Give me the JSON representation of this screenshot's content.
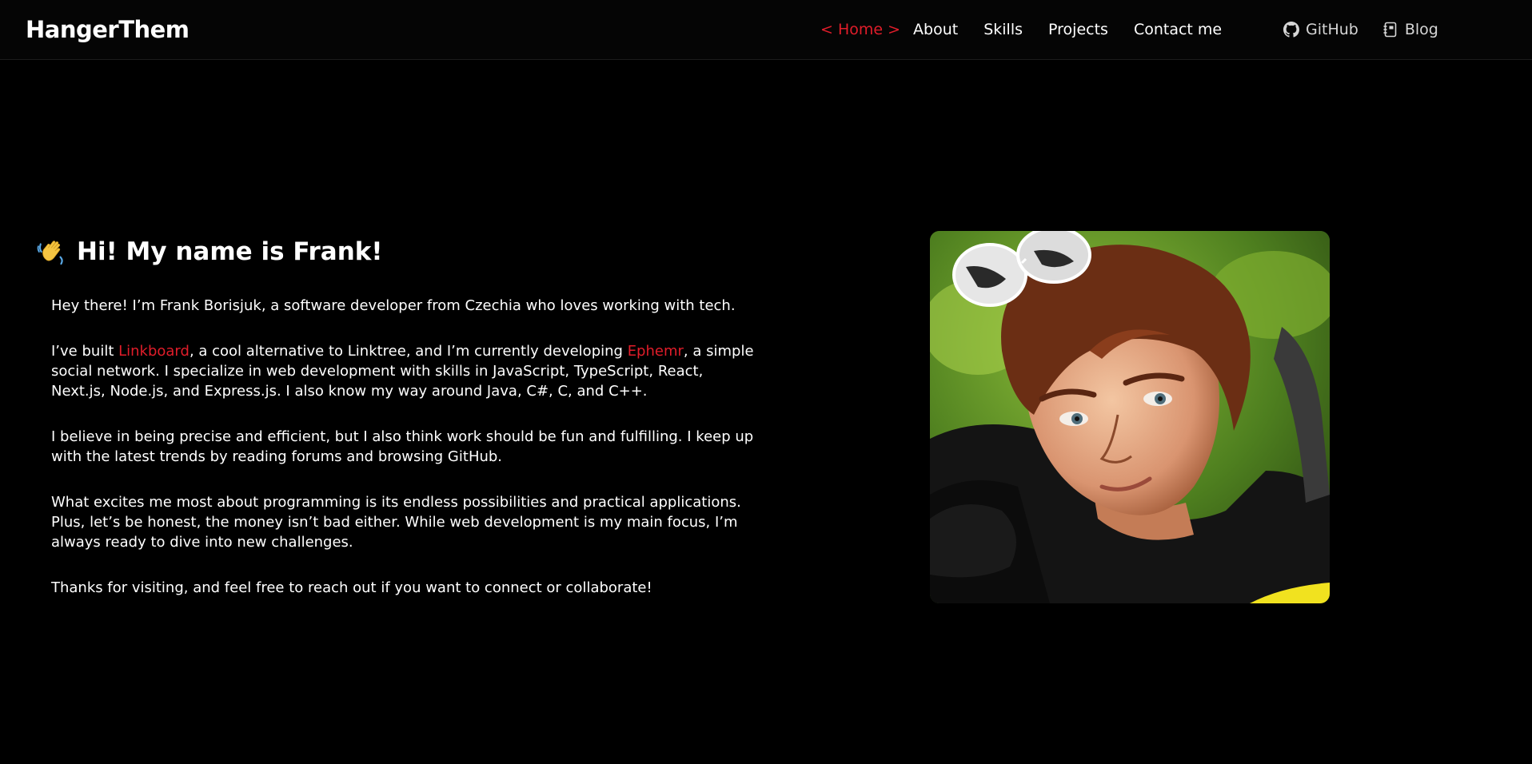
{
  "header": {
    "logo": "HangerThem",
    "nav": {
      "home": "< Home >",
      "about": "About",
      "skills": "Skills",
      "projects": "Projects",
      "contact": "Contact me"
    },
    "external": {
      "github": "GitHub",
      "blog": "Blog"
    }
  },
  "hero": {
    "title": "Hi! My name is Frank!",
    "p1": "Hey there! I’m Frank Borisjuk, a software developer from Czechia who loves working with tech.",
    "p2": {
      "t1": "I’ve built ",
      "link1": "Linkboard",
      "t2": ", a cool alternative to Linktree, and I’m currently developing ",
      "link2": "Ephemr",
      "t3": ", a simple social network. I specialize in web development with skills in JavaScript, TypeScript, React, Next.js, Node.js, and Express.js. I also know my way around Java, C#, C, and C++."
    },
    "p3": "I believe in being precise and efficient, but I also think work should be fun and fulfilling. I keep up with the latest trends by reading forums and browsing GitHub.",
    "p4": "What excites me most about programming is its endless possibilities and practical applications. Plus, let’s be honest, the money isn’t bad either. While web development is my main focus, I’m always ready to dive into new challenges.",
    "p5": "Thanks for visiting, and feel free to reach out if you want to connect or collaborate!"
  },
  "colors": {
    "accent": "#e11d2a",
    "background": "#000000",
    "text": "#ffffff"
  },
  "icons": {
    "wave": "waving-hand-icon",
    "github": "github-icon",
    "blog": "notebook-icon"
  }
}
